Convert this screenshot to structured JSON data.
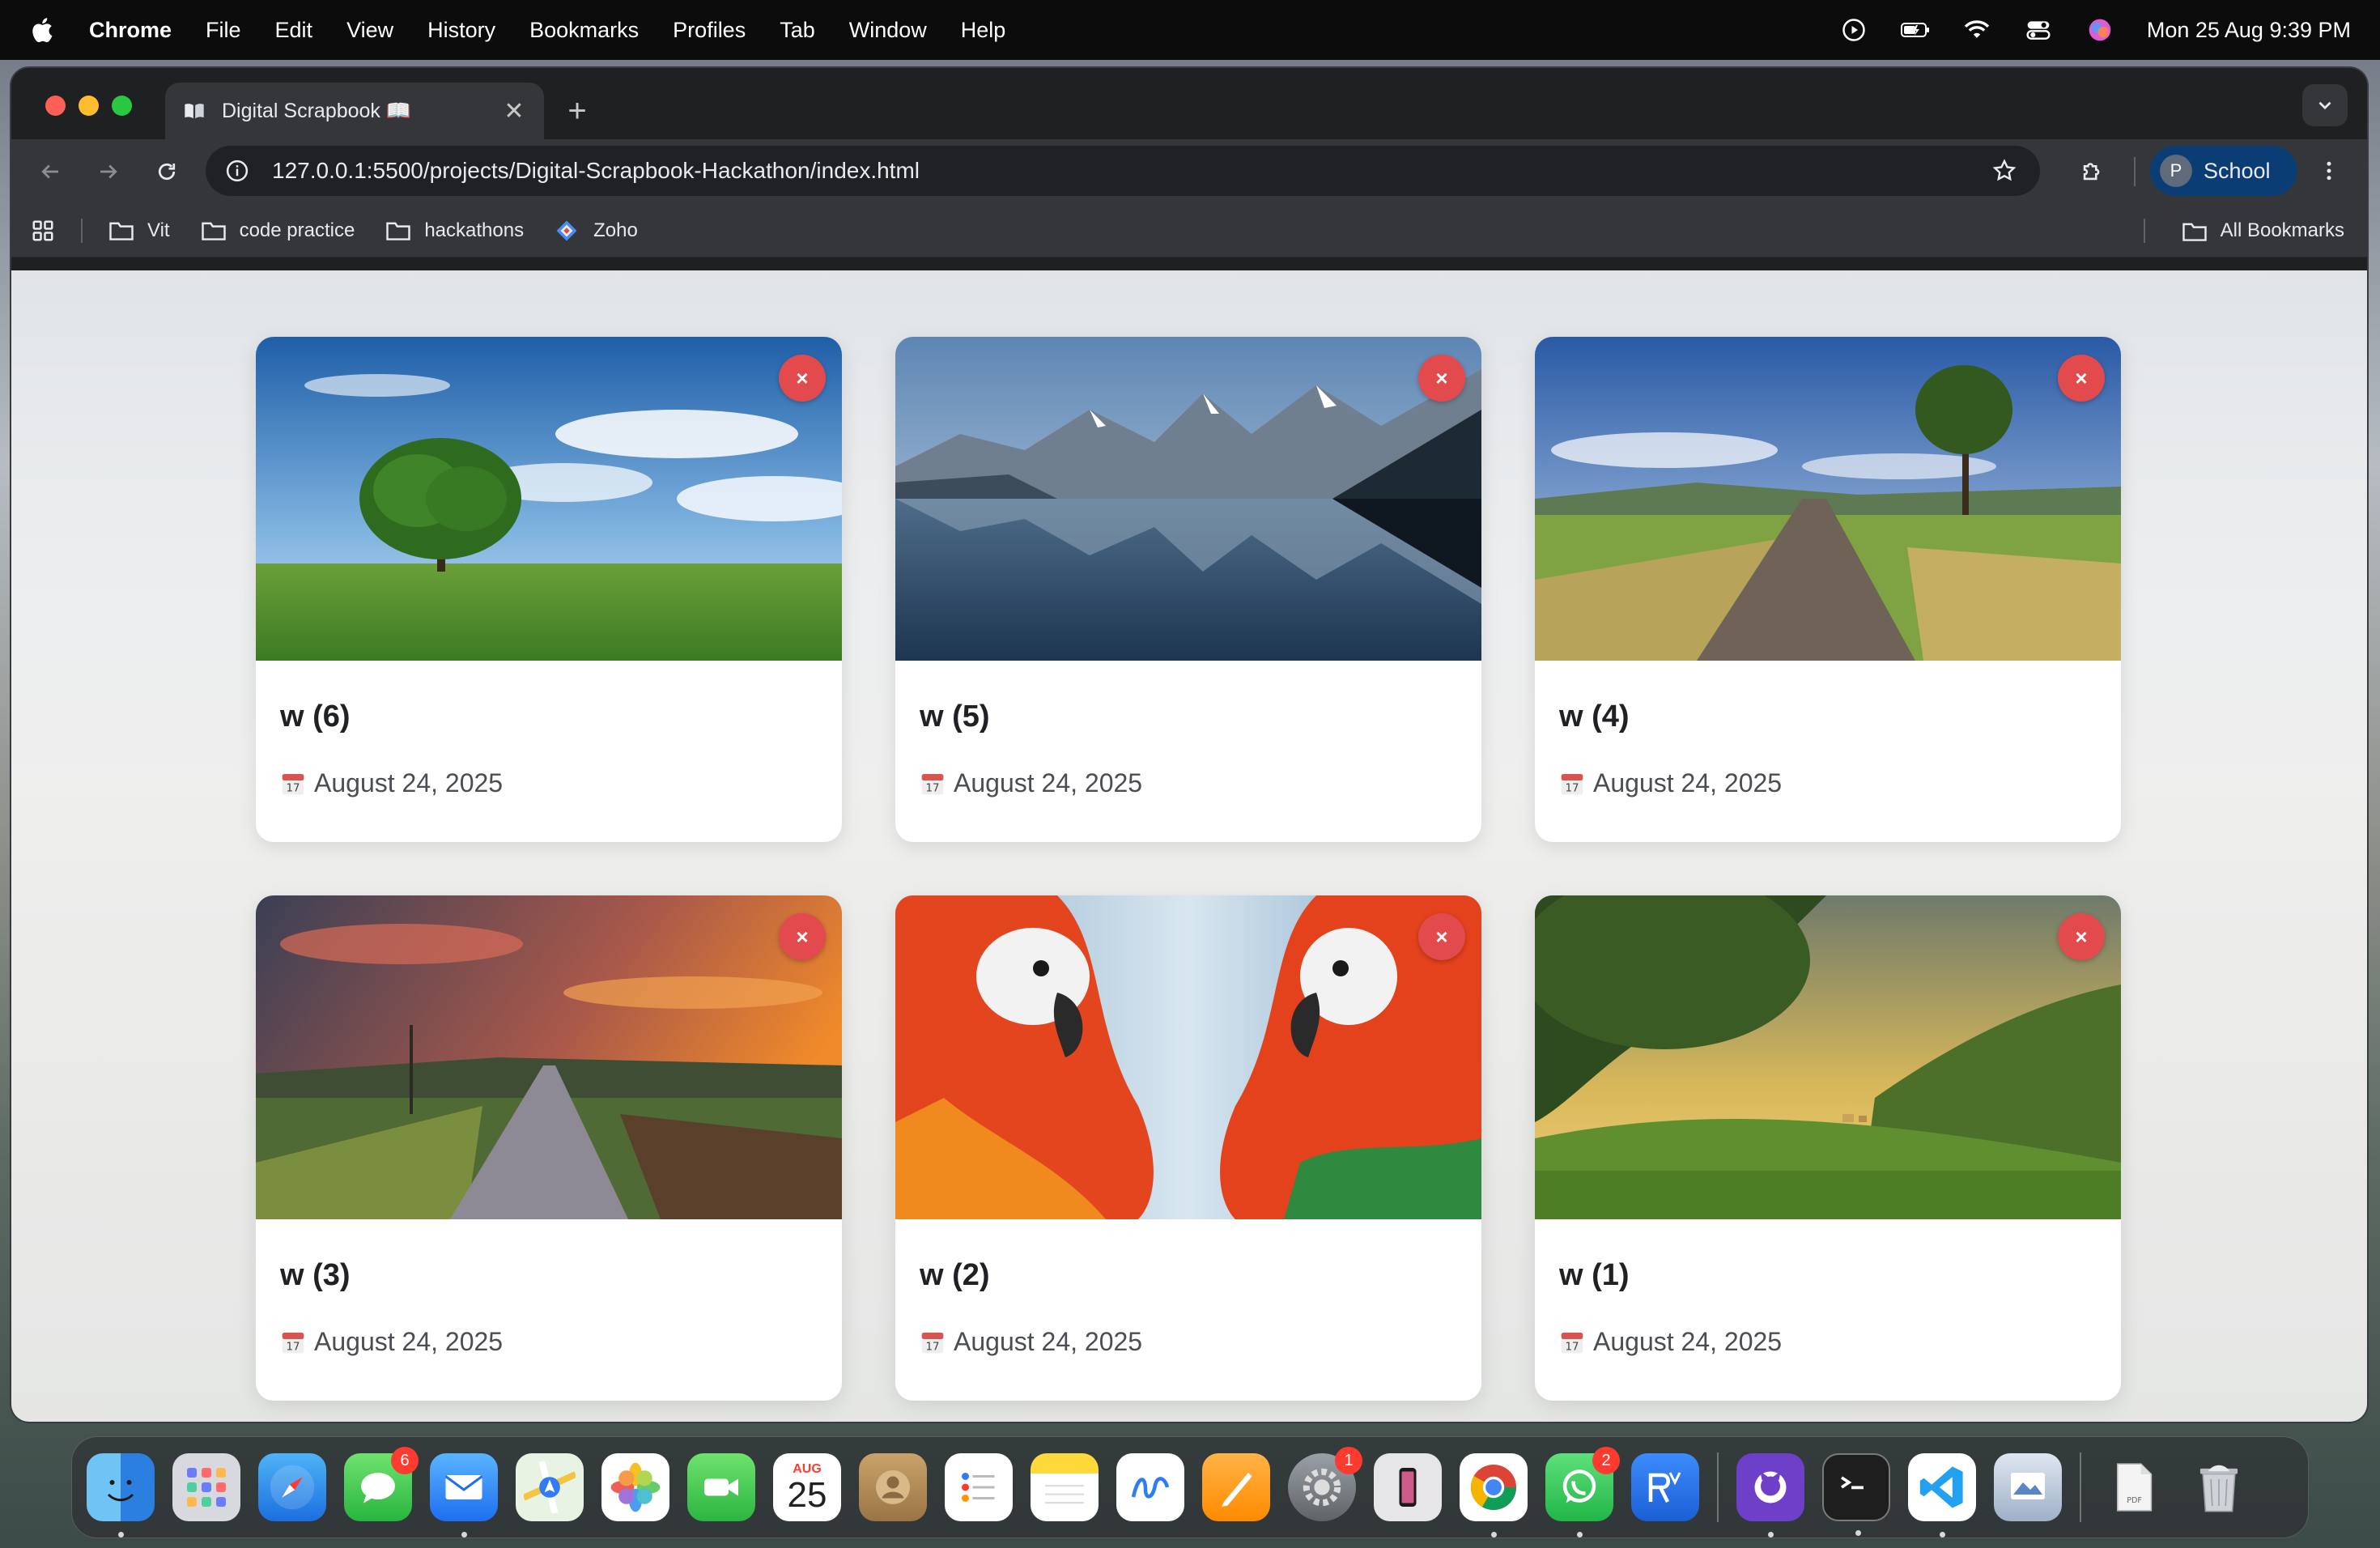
{
  "menubar": {
    "app_name": "Chrome",
    "menus": [
      "File",
      "Edit",
      "View",
      "History",
      "Bookmarks",
      "Profiles",
      "Tab",
      "Window",
      "Help"
    ],
    "datetime": "Mon 25 Aug  9:39 PM"
  },
  "browser": {
    "tab_title": "Digital Scrapbook 📖",
    "url": "127.0.0.1:5500/projects/Digital-Scrapbook-Hackathon/index.html",
    "profile_initial": "P",
    "profile_label": "School",
    "bookmarks": [
      "Vit",
      "code practice",
      "hackathons",
      "Zoho"
    ],
    "all_bookmarks": "All Bookmarks"
  },
  "cards": [
    {
      "title": "w (6)",
      "date": "August 24, 2025",
      "delete_label": "×",
      "image": "tree-field"
    },
    {
      "title": "w (5)",
      "date": "August 24, 2025",
      "delete_label": "×",
      "image": "mountain-lake"
    },
    {
      "title": "w (4)",
      "date": "August 24, 2025",
      "delete_label": "×",
      "image": "country-road"
    },
    {
      "title": "w (3)",
      "date": "August 24, 2025",
      "delete_label": "×",
      "image": "sunset-road"
    },
    {
      "title": "w (2)",
      "date": "August 24, 2025",
      "delete_label": "×",
      "image": "macaws"
    },
    {
      "title": "w (1)",
      "date": "August 24, 2025",
      "delete_label": "×",
      "image": "green-valley"
    }
  ],
  "dock": {
    "badges": {
      "messages": "6",
      "settings": "1",
      "whatsapp": "2"
    },
    "calendar_month": "AUG",
    "calendar_day": "25"
  }
}
